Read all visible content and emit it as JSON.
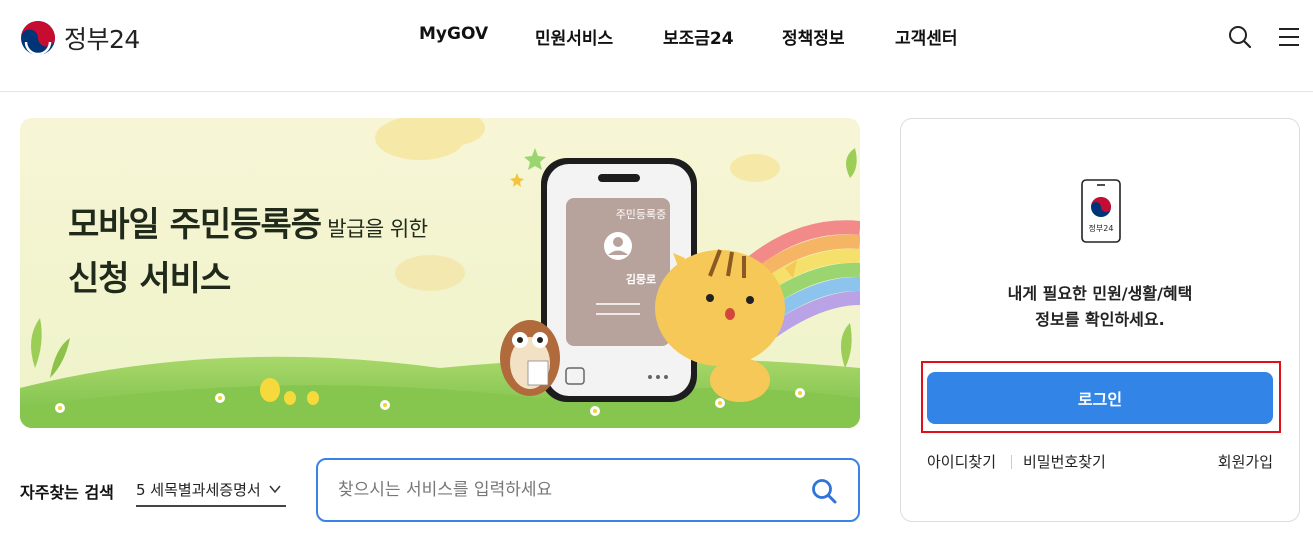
{
  "header": {
    "logo_text": "정부24",
    "nav": [
      "MyGOV",
      "민원서비스",
      "보조금24",
      "정책정보",
      "고객센터"
    ],
    "icons": {
      "search": "search-icon",
      "menu": "hamburger-menu-icon"
    }
  },
  "banner": {
    "title_line1": "모바일 주민등록증",
    "title_line1_sub": " 발급을 위한",
    "title_line2": "신청 서비스",
    "phone_card_title": "주민등록증",
    "phone_card_name": "김뭉로"
  },
  "search": {
    "frequent_label": "자주찾는 검색",
    "frequent_selected": "5 세목별과세증명서",
    "placeholder": "찾으시는 서비스를 입력하세요"
  },
  "login_panel": {
    "phone_logo_text": "정부24",
    "message_line1": "내게 필요한 민원/생활/혜택",
    "message_line2": "정보를 확인하세요.",
    "login_button": "로그인",
    "find_id": "아이디찾기",
    "find_password": "비밀번호찾기",
    "signup": "회원가입"
  },
  "colors": {
    "accent_blue": "#3285e6",
    "highlight_red": "#e0101a",
    "logo_red": "#c60c30",
    "logo_blue": "#003478"
  }
}
